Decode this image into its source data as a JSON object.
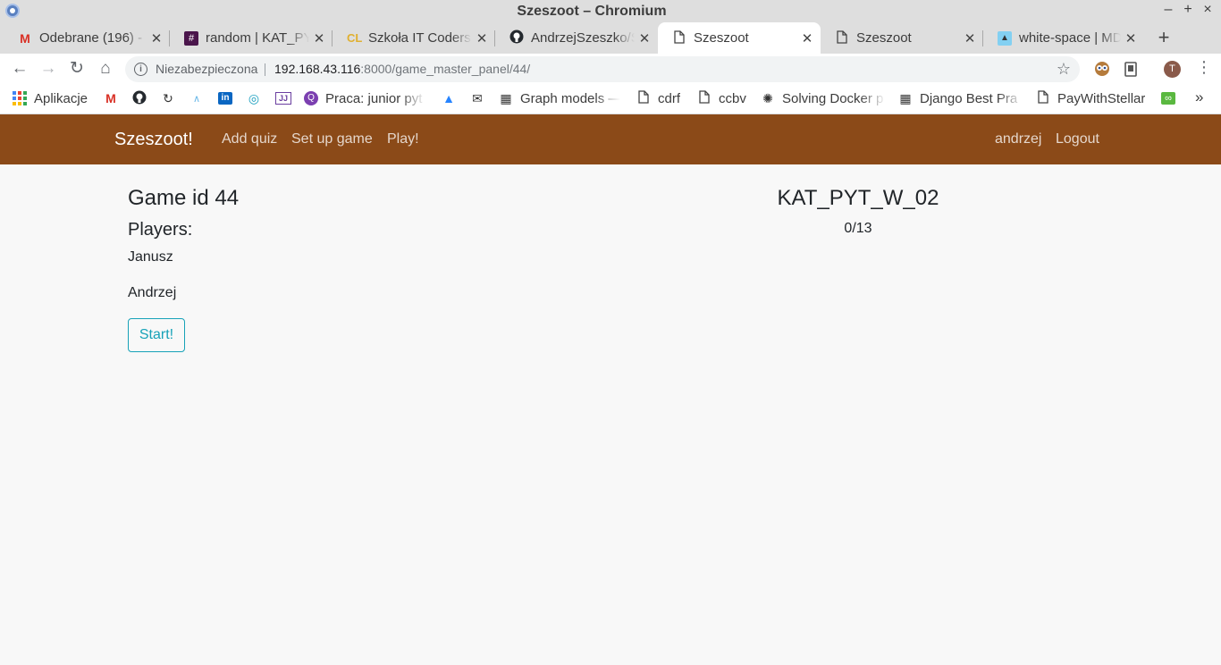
{
  "window": {
    "title": "Szeszoot – Chromium",
    "controls": {
      "minimize": "–",
      "maximize": "+",
      "close": "×"
    }
  },
  "tabs": [
    {
      "label": "Odebrane (196) - ",
      "icon": "gmail-icon",
      "active": false
    },
    {
      "label": "random | KAT_PY",
      "icon": "slack-icon",
      "active": false
    },
    {
      "label": "Szkoła IT Coders ",
      "icon": "coderslab-icon",
      "active": false
    },
    {
      "label": "AndrzejSzeszko/S",
      "icon": "github-icon",
      "active": false
    },
    {
      "label": "Szeszoot",
      "icon": "page-icon",
      "active": true
    },
    {
      "label": "Szeszoot",
      "icon": "page-icon",
      "active": false
    },
    {
      "label": "white-space | MD",
      "icon": "mdn-icon",
      "active": false
    }
  ],
  "toolbar": {
    "security_label": "Niezabezpieczona",
    "url_host": "192.168.43.116",
    "url_rest": ":8000/game_master_panel/44/",
    "profile_initial": "T"
  },
  "bookmarks": [
    {
      "label": "Aplikacje",
      "icon": "apps-grid-icon"
    },
    {
      "label": "",
      "icon": "gmail-icon"
    },
    {
      "label": "",
      "icon": "github-icon"
    },
    {
      "label": "",
      "icon": "refresh-logo-icon"
    },
    {
      "label": "",
      "icon": "bird-icon"
    },
    {
      "label": "",
      "icon": "linkedin-icon"
    },
    {
      "label": "",
      "icon": "target-icon"
    },
    {
      "label": "",
      "icon": "jetbrains-icon"
    },
    {
      "label": "Praca: junior pyt",
      "icon": "praca-icon"
    },
    {
      "label": "",
      "icon": "atlassian-icon"
    },
    {
      "label": "",
      "icon": "envelope-icon"
    },
    {
      "label": "Graph models —",
      "icon": "building-icon"
    },
    {
      "label": "cdrf",
      "icon": "page-icon"
    },
    {
      "label": "ccbv",
      "icon": "page-icon"
    },
    {
      "label": "Solving Docker p",
      "icon": "docker-icon"
    },
    {
      "label": "Django Best Pra",
      "icon": "building-icon"
    },
    {
      "label": "PayWithStellar",
      "icon": "page-icon"
    },
    {
      "label": "",
      "icon": "stellar-icon"
    }
  ],
  "app_nav": {
    "brand": "Szeszoot!",
    "links": [
      "Add quiz",
      "Set up game",
      "Play!"
    ],
    "user": "andrzej",
    "logout": "Logout"
  },
  "main": {
    "game_id_text": "Game id 44",
    "players_heading": "Players:",
    "players": [
      "Janusz",
      "Andrzej"
    ],
    "start_label": "Start!",
    "quiz_name": "KAT_PYT_W_02",
    "progress": "0/13"
  },
  "colors": {
    "navbar_bg": "#8b4a18",
    "start_button": "#17a2b8",
    "page_bg": "#f8f8f8"
  }
}
